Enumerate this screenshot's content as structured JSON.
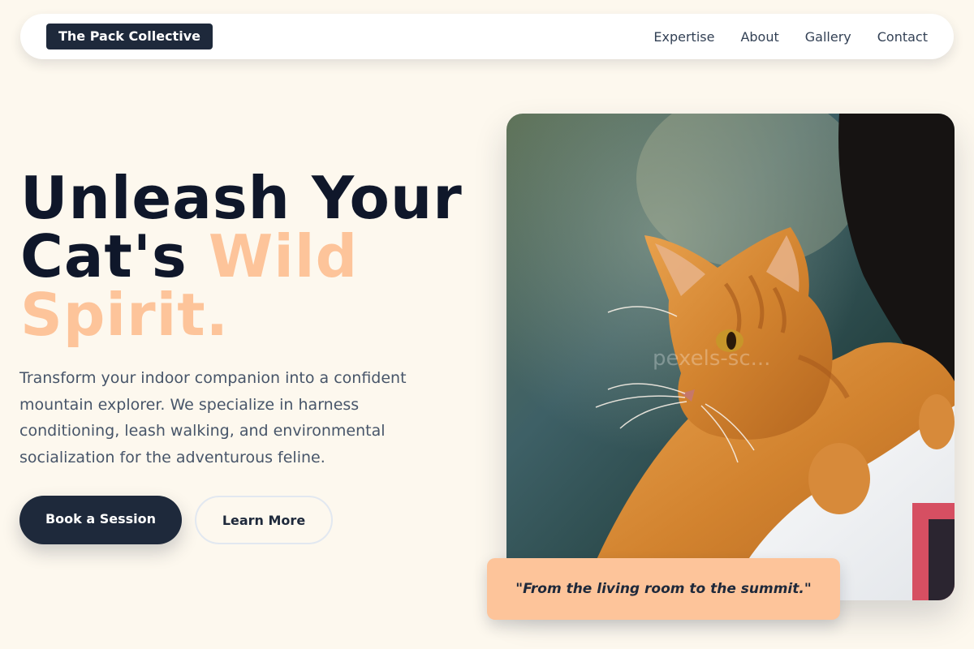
{
  "nav": {
    "brand": "The Pack Collective",
    "links": [
      "Expertise",
      "About",
      "Gallery",
      "Contact"
    ]
  },
  "hero": {
    "title_line1": "Unleash Your",
    "title_line2_plain": "Cat's ",
    "title_line2_accent": "Wild",
    "title_line3_accent": "Spirit.",
    "description": "Transform your indoor companion into a confident mountain explorer. We specialize in harness conditioning, leash walking, and environmental socialization for the adventurous feline.",
    "primary_button": "Book a Session",
    "secondary_button": "Learn More"
  },
  "image": {
    "watermark": "pexels-sc..."
  },
  "quote": "\"From the living room to the summit.\"",
  "colors": {
    "background": "#fdf8ee",
    "dark": "#1e293b",
    "accent": "#fdc49a",
    "body_text": "#475569"
  }
}
